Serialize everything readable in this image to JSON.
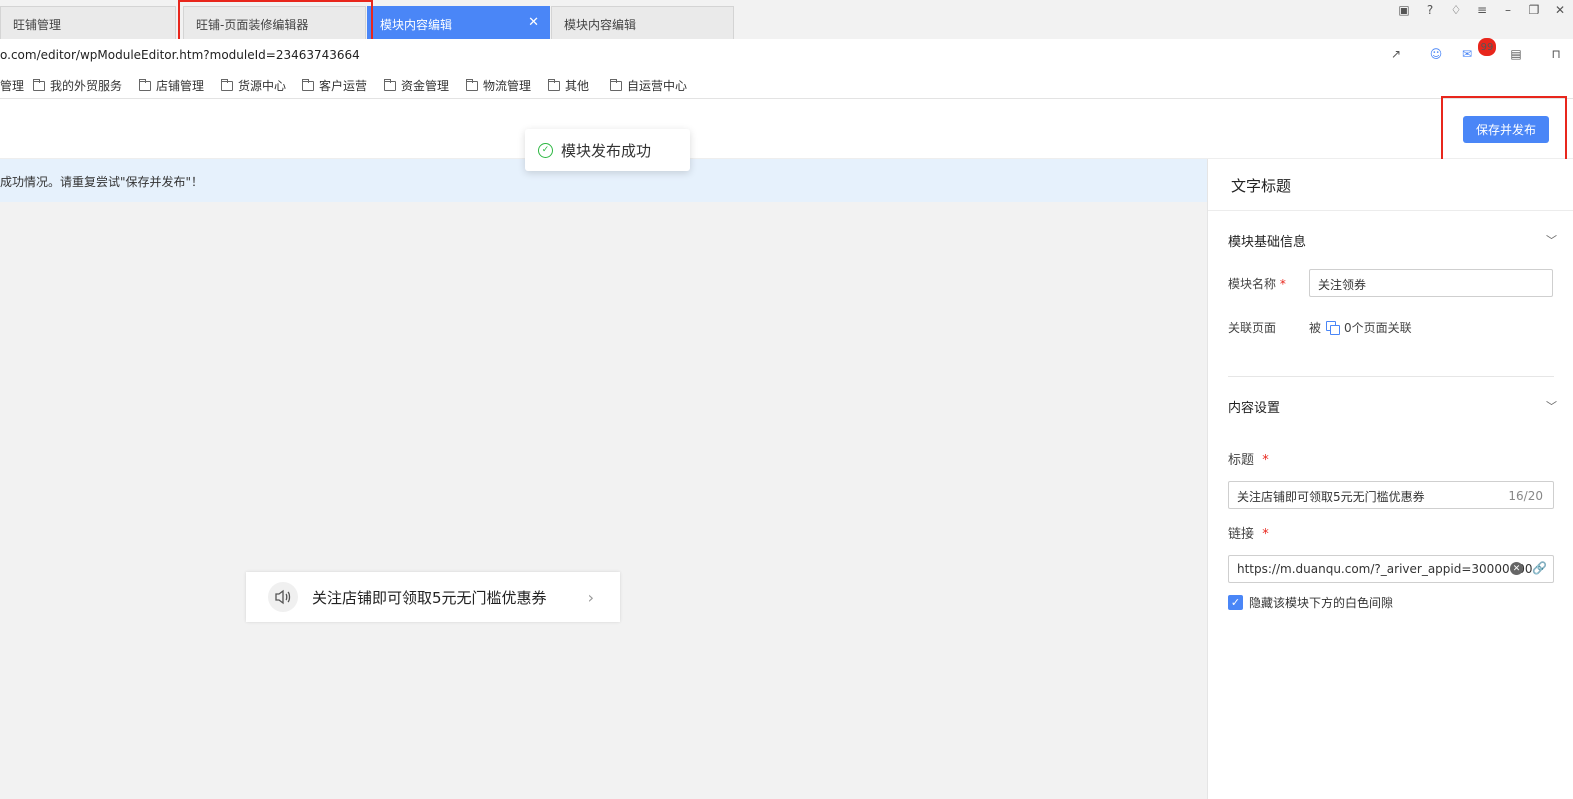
{
  "tabs": [
    {
      "label": "旺铺管理"
    },
    {
      "label": "旺铺-页面装修编辑器"
    },
    {
      "label": "模块内容编辑"
    },
    {
      "label": "模块内容编辑"
    }
  ],
  "address": {
    "url": "o.com/editor/wpModuleEditor.htm?moduleId=23463743664",
    "mail_badge": "99"
  },
  "bookmarks": [
    {
      "label": "管理"
    },
    {
      "label": "我的外贸服务"
    },
    {
      "label": "店铺管理"
    },
    {
      "label": "货源中心"
    },
    {
      "label": "客户运营"
    },
    {
      "label": "资金管理"
    },
    {
      "label": "物流管理"
    },
    {
      "label": "其他"
    },
    {
      "label": "自运营中心"
    }
  ],
  "header": {
    "save_label": "保存并发布",
    "toast": "模块发布成功"
  },
  "canvas": {
    "notice": "成功情况。请重复尝试\"保存并发布\"！",
    "preview_text": "关注店铺即可领取5元无门槛优惠券"
  },
  "panel": {
    "title": "文字标题",
    "basic_section": "模块基础信息",
    "name_label": "模块名称",
    "required_mark": "*",
    "name_value": "关注领券",
    "relation_label": "关联页面",
    "relation_prefix": "被",
    "relation_text": "0个页面关联",
    "content_section": "内容设置",
    "heading_label": "标题",
    "heading_value": "关注店铺即可领取5元无门槛优惠券",
    "heading_counter": "16/20",
    "link_label": "链接",
    "link_value": "https://m.duanqu.com/?_ariver_appid=30000000",
    "checkbox_label": "隐藏该模块下方的白色间隙",
    "checkbox_checked": true
  },
  "colors": {
    "accent": "#4a86f7",
    "highlight_box": "#e8261c",
    "success": "#2db742",
    "notice_bg": "#e6f1fc"
  }
}
